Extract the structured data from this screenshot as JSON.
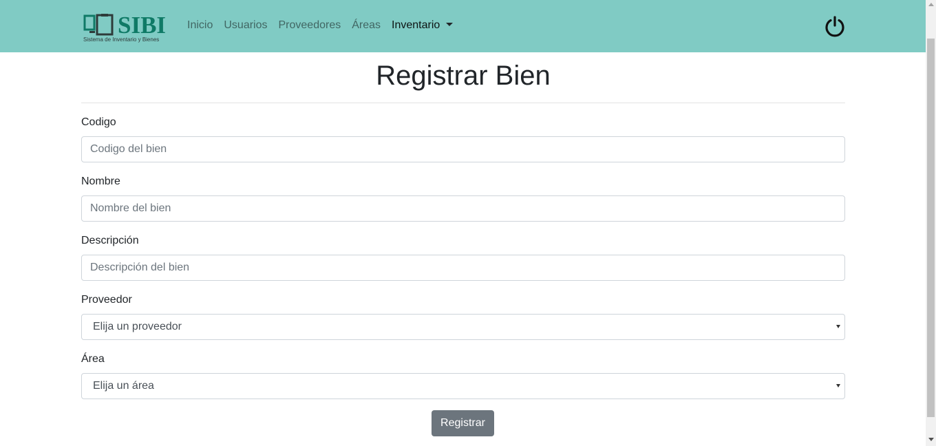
{
  "brand": {
    "name": "SIBI",
    "tagline": "Sistema de Inventario y Bienes"
  },
  "nav": {
    "items": [
      {
        "label": "Inicio"
      },
      {
        "label": "Usuarios"
      },
      {
        "label": "Proveedores"
      },
      {
        "label": "Áreas"
      },
      {
        "label": "Inventario"
      }
    ],
    "logout_icon": "power-icon"
  },
  "page": {
    "title": "Registrar Bien"
  },
  "form": {
    "codigo": {
      "label": "Codigo",
      "placeholder": "Codigo del bien",
      "value": ""
    },
    "nombre": {
      "label": "Nombre",
      "placeholder": "Nombre del bien",
      "value": ""
    },
    "descripcion": {
      "label": "Descripción",
      "placeholder": "Descripción del bien",
      "value": ""
    },
    "proveedor": {
      "label": "Proveedor",
      "selected": "Elija un proveedor"
    },
    "area": {
      "label": "Área",
      "selected": "Elija un área"
    },
    "submit_label": "Registrar"
  },
  "colors": {
    "navbar": "#80cbc4",
    "brand": "#0f7a66",
    "button": "#6c757d"
  }
}
